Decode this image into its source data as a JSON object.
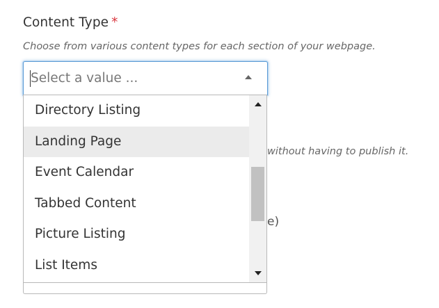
{
  "field": {
    "label": "Content Type",
    "required_marker": "*",
    "help": "Choose from various content types for each section of your webpage."
  },
  "select": {
    "placeholder": "Select a value ...",
    "value": ""
  },
  "dropdown": {
    "options": [
      {
        "label": "Directory Listing"
      },
      {
        "label": "Landing Page",
        "hovered": true
      },
      {
        "label": "Event Calendar"
      },
      {
        "label": "Tabbed Content"
      },
      {
        "label": "Picture Listing"
      },
      {
        "label": "List Items"
      }
    ],
    "scroll_position": 0.55
  },
  "background_fragments": {
    "help_text": "without having to publish it.",
    "partial_text": "e)"
  },
  "colors": {
    "required": "#d9363e",
    "focus_border": "#5b9bd5",
    "hover_bg": "#ebebeb"
  }
}
